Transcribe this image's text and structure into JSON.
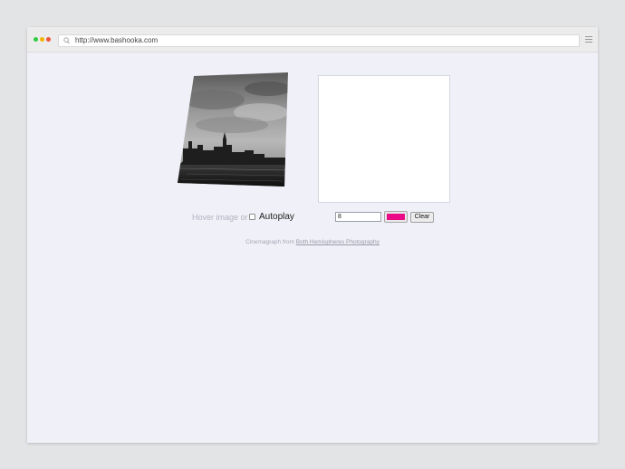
{
  "browser": {
    "url": "http://www.bashooka.com",
    "url_icon": "search-icon",
    "menu_icon": "hamburger-menu-icon"
  },
  "demo": {
    "hover_text": "Hover image or",
    "autoplay_label": "Autoplay",
    "autoplay_checked": false,
    "brush_size_value": "8",
    "brush_color": "#ea0b87",
    "clear_label": "Clear"
  },
  "credit": {
    "prefix": "Cinemagraph from ",
    "link_text": "Both Hemispheres Photography"
  },
  "colors": {
    "page_background": "#f0f0f8",
    "outer_background": "#e3e4e6"
  }
}
